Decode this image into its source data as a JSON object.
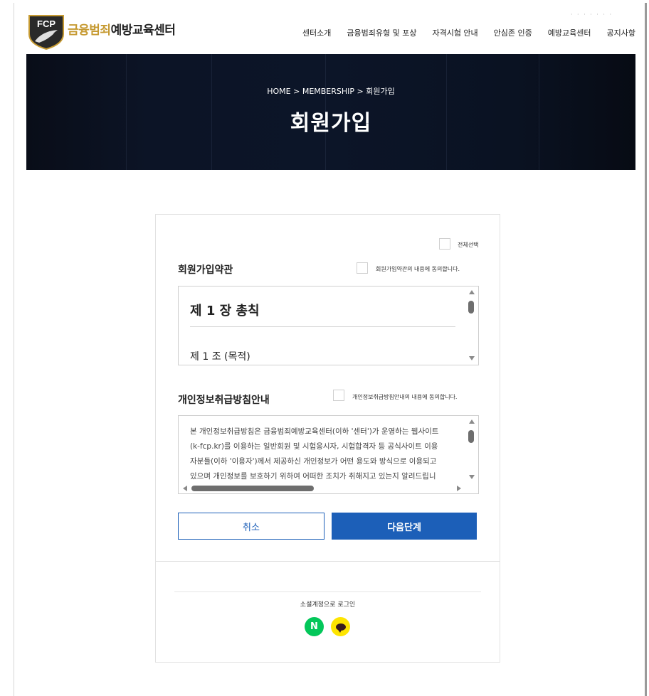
{
  "header": {
    "logo_text": "FCP",
    "brand_gold": "금융범죄",
    "brand_dark": "예방교육센터",
    "nav": [
      "센터소개",
      "금융범죄유형 및 포상",
      "자격시험 안내",
      "안심존 인증",
      "예방교육센터",
      "공지사항"
    ]
  },
  "banner": {
    "breadcrumb": "HOME > MEMBERSHIP > 회원가입",
    "title": "회원가입"
  },
  "form": {
    "select_all_label": "전체선택",
    "terms": {
      "title": "회원가입약관",
      "agree_label": "회원가입약관의 내용에 동의합니다.",
      "chapter": "제 1 장 총칙",
      "article": "제 1 조 (목적)"
    },
    "privacy": {
      "title": "개인정보취급방침안내",
      "agree_label": "개인정보취급방침안내의 내용에 동의합니다.",
      "lines": [
        "본 개인정보취급방침은 금융범죄예방교육센터(이하 '센터')가 운영하는 웹사이트",
        "(k-fcp.kr)를 이용하는 일반회원 및 시험응시자, 시험합격자 등 공식사이트 이용",
        "자분들(이하 '이용자')께서 제공하신 개인정보가 어떤 용도와 방식으로 이용되고",
        "있으며 개인정보를 보호하기 위하여 어떠한 조치가 취해지고 있는지 알려드립니"
      ]
    },
    "cancel_label": "취소",
    "next_label": "다음단계"
  },
  "social": {
    "label": "소셜계정으로 로그인",
    "naver_letter": "N",
    "colors": {
      "naver": "#03c75a",
      "kakao": "#fee500"
    }
  },
  "colors": {
    "primary": "#1c5fb8",
    "brand_gold": "#c69a32",
    "banner_bg": "#0c1426"
  }
}
